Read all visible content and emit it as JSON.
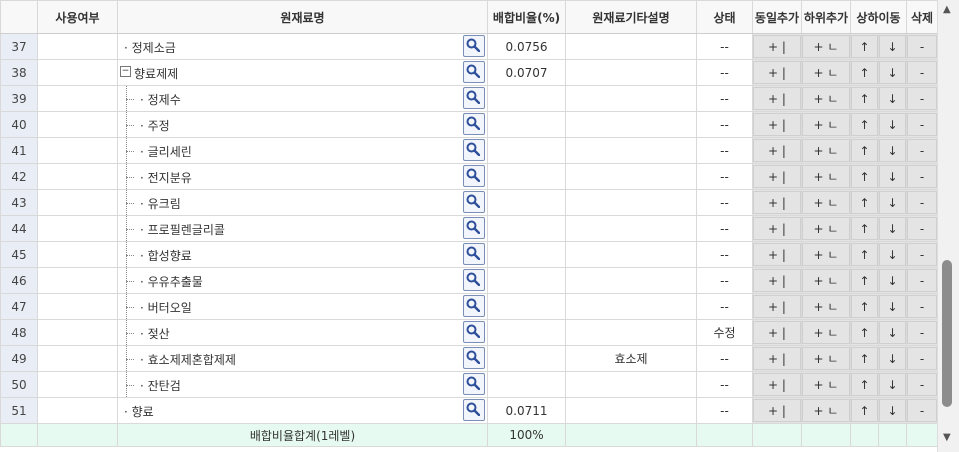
{
  "headers": {
    "use": "사용여부",
    "name": "원재료명",
    "ratio": "배합비율(%)",
    "desc": "원재료기타설명",
    "status": "상태",
    "add_same": "동일추가",
    "add_child": "하위추가",
    "move": "상하이동",
    "del": "삭제"
  },
  "button_labels": {
    "add_same": "+ |",
    "add_child": "+ ㄴ",
    "up": "↑",
    "down": "↓",
    "del": "-"
  },
  "rows": [
    {
      "no": "37",
      "name": "· 정제소금",
      "level": 0,
      "ratio": "0.0756",
      "desc": "",
      "status": "--"
    },
    {
      "no": "38",
      "name": "향료제제",
      "level": 0,
      "toggle": "−",
      "ratio": "0.0707",
      "desc": "",
      "status": "--"
    },
    {
      "no": "39",
      "name": "· 정제수",
      "level": 1,
      "ratio": "",
      "desc": "",
      "status": "--"
    },
    {
      "no": "40",
      "name": "· 주정",
      "level": 1,
      "ratio": "",
      "desc": "",
      "status": "--"
    },
    {
      "no": "41",
      "name": "· 글리세린",
      "level": 1,
      "ratio": "",
      "desc": "",
      "status": "--"
    },
    {
      "no": "42",
      "name": "· 전지분유",
      "level": 1,
      "ratio": "",
      "desc": "",
      "status": "--"
    },
    {
      "no": "43",
      "name": "· 유크림",
      "level": 1,
      "ratio": "",
      "desc": "",
      "status": "--"
    },
    {
      "no": "44",
      "name": "· 프로필렌글리콜",
      "level": 1,
      "ratio": "",
      "desc": "",
      "status": "--"
    },
    {
      "no": "45",
      "name": "· 합성향료",
      "level": 1,
      "ratio": "",
      "desc": "",
      "status": "--"
    },
    {
      "no": "46",
      "name": "· 우유추출물",
      "level": 1,
      "ratio": "",
      "desc": "",
      "status": "--"
    },
    {
      "no": "47",
      "name": "· 버터오일",
      "level": 1,
      "ratio": "",
      "desc": "",
      "status": "--"
    },
    {
      "no": "48",
      "name": "· 젖산",
      "level": 1,
      "ratio": "",
      "desc": "",
      "status": "수정"
    },
    {
      "no": "49",
      "name": "· 효소제제혼합제제",
      "level": 1,
      "ratio": "",
      "desc": "효소제",
      "status": "--"
    },
    {
      "no": "50",
      "name": "· 잔탄검",
      "level": 1,
      "ratio": "",
      "desc": "",
      "status": "--"
    },
    {
      "no": "51",
      "name": "· 향료",
      "level": 0,
      "ratio": "0.0711",
      "desc": "",
      "status": "--"
    }
  ],
  "footer": {
    "label": "배합비율합계(1레벨)",
    "total": "100%"
  },
  "scrollbar": {
    "up_glyph": "▲",
    "down_glyph": "▼"
  },
  "colors": {
    "row_number_bg": "#e9eef6",
    "footer_bg": "#e6faf2",
    "button_bg": "#e4e4e4",
    "search_icon": "#2e4f9a"
  }
}
